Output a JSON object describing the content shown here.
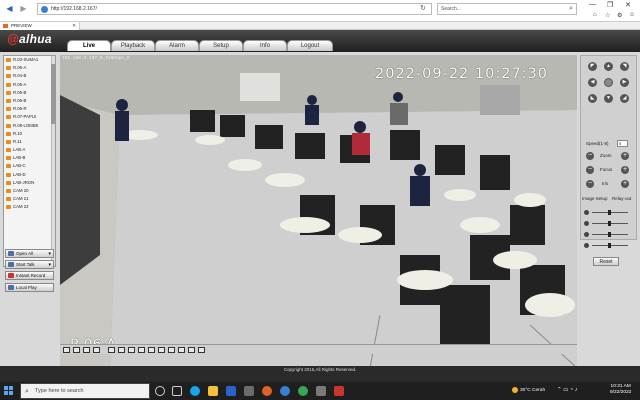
{
  "browser": {
    "address": "http://192.168.2.167/",
    "search_placeholder": "Search...",
    "tab_title": "PREVIEW",
    "back_icon": "back-arrow-icon",
    "forward_icon": "forward-arrow-icon"
  },
  "app": {
    "logo": "alhua",
    "tabs": [
      "Live",
      "Playback",
      "Alarm",
      "Setup",
      "Info",
      "Logout"
    ],
    "active_tab": "Live",
    "cameras": [
      "R.03-SUMA1",
      "R.06-A",
      "R.04-B",
      "R.05-A",
      "R.05-B",
      "R.06-B",
      "R.06-R",
      "R.07-PAPUI",
      "R.08-LOMBK",
      "R.10",
      "R.11",
      "LAB-A",
      "LAB-B",
      "LAB-C",
      "LAB-D",
      "LAB-JRGN",
      "CAM 20",
      "CAM 21",
      "CAM 22"
    ],
    "left_buttons": [
      "Open All",
      "Start Talk",
      "Instant Record",
      "Local Play"
    ],
    "video": {
      "info": "192.168.2.167_0_918Kbps_H",
      "timestamp": "2022-09-22 10:27:30",
      "camera_name": "R.06-A"
    },
    "ptz": {
      "speed_label": "Speed(1-8)",
      "speed_value": "5",
      "zoom_label": "Zoom",
      "focus_label": "Focus",
      "iris_label": "Iris",
      "image_setup_label": "Image Setup",
      "relay_out_label": "Relay-out",
      "reset_label": "Reset"
    },
    "copyright": "Copyright 2015,All Rights Reserved."
  },
  "taskbar": {
    "search_placeholder": "Type here to search",
    "weather": "30°C  Cerah",
    "time": "10:31 AM",
    "date": "9/22/2022"
  }
}
